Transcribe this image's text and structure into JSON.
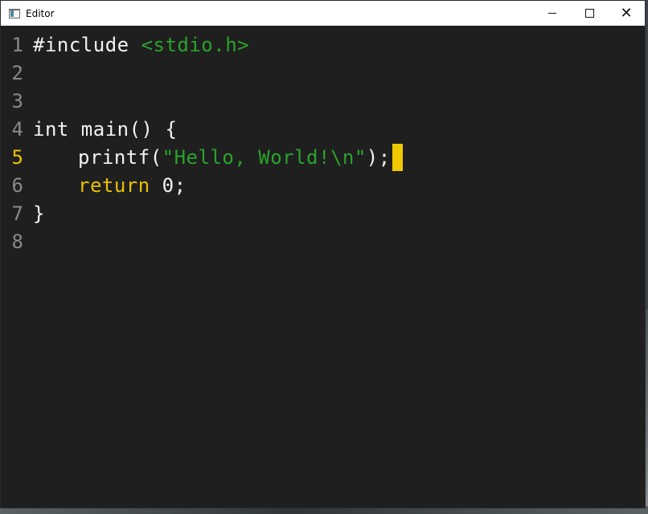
{
  "window": {
    "title": "Editor",
    "controls": {
      "minimize": "minimize",
      "maximize": "maximize",
      "close": "close"
    }
  },
  "editor": {
    "active_line": 5,
    "lines": [
      {
        "number": "1",
        "tokens": [
          {
            "text": "#include ",
            "color": "#f2f2f2"
          },
          {
            "text": "<stdio.h>",
            "color": "#2aa32a"
          }
        ]
      },
      {
        "number": "2",
        "tokens": []
      },
      {
        "number": "3",
        "tokens": []
      },
      {
        "number": "4",
        "tokens": [
          {
            "text": "int main() {",
            "color": "#f2f2f2"
          }
        ]
      },
      {
        "number": "5",
        "tokens": [
          {
            "text": "printf(",
            "color": "#f2f2f2"
          },
          {
            "text": "\"Hello, World!\\n\"",
            "color": "#2aa32a"
          },
          {
            "text": ");",
            "color": "#f2f2f2"
          }
        ]
      },
      {
        "number": "6",
        "tokens": [
          {
            "text": "return",
            "color": "#e8c200"
          },
          {
            "text": " 0;",
            "color": "#f2f2f2"
          }
        ]
      },
      {
        "number": "7",
        "tokens": [
          {
            "text": "}",
            "color": "#f2f2f2"
          }
        ]
      },
      {
        "number": "8",
        "tokens": []
      }
    ]
  },
  "colors": {
    "background": "#1f1f1f",
    "line_number": "#8a8a8a",
    "active_line_number": "#e8c200",
    "string": "#2aa32a",
    "keyword": "#e8c200",
    "cursor": "#f0c800"
  }
}
